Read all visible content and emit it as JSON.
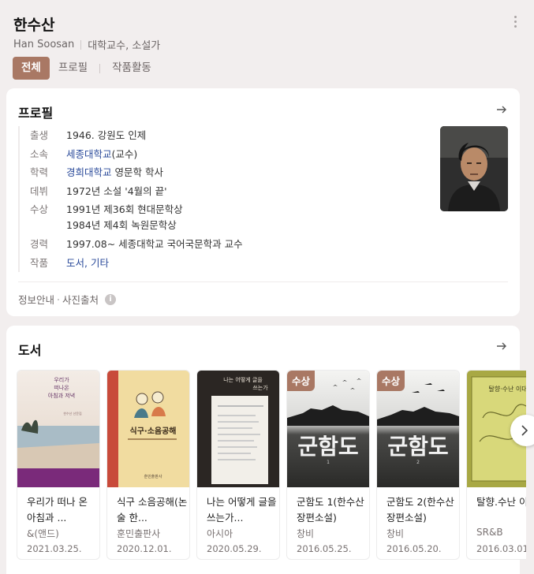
{
  "header": {
    "name": "한수산",
    "name_en": "Han Soosan",
    "occupation": "대학교수, 소설가",
    "tabs": [
      "전체",
      "프로필",
      "작품활동"
    ]
  },
  "profile": {
    "title": "프로필",
    "rows": [
      {
        "label": "출생",
        "value": "1946. 강원도 인제"
      },
      {
        "label": "소속",
        "link": "세종대학교",
        "suffix": "(교수)"
      },
      {
        "label": "학력",
        "link": "경희대학교",
        "suffix": " 영문학 학사"
      },
      {
        "label": "데뷔",
        "value": "1972년 소설 '4월의 끝'"
      },
      {
        "label": "수상",
        "values": [
          "1991년 제36회 현대문학상",
          "1984년 제4회 녹원문학상"
        ]
      },
      {
        "label": "경력",
        "value": "1997.08~ 세종대학교 국어국문학과 교수"
      },
      {
        "label": "작품",
        "link": "도서, 기타"
      }
    ],
    "info_label": "정보안내",
    "photo_source_label": "사진출처",
    "info_icon": "i"
  },
  "books": {
    "title": "도서",
    "badge_label": "수상",
    "items": [
      {
        "title": "우리가 떠나온 아침과 저녁",
        "display_title": "우리가 떠나 온 아침과 ...",
        "publisher": "&(앤드)",
        "date": "2021.03.25.",
        "cover_text": "우리가\n떠나온\n아침과 저녁",
        "award": false
      },
      {
        "title": "식구 소음공해(논술 한...)",
        "display_title": "식구 소음공해(논술 한...",
        "publisher": "훈민출판사",
        "date": "2020.12.01.",
        "cover_text": "식구·소음공해",
        "award": false
      },
      {
        "title": "나는 어떻게 글을 쓰는가",
        "display_title": "나는 어떻게 글을 쓰는가...",
        "publisher": "아시아",
        "date": "2020.05.29.",
        "cover_text": "나는 어떻게 글을\n쓰는가",
        "award": false
      },
      {
        "title": "군함도 1(한수산 장편소설)",
        "display_title": "군함도 1(한수산 장편소설)",
        "publisher": "창비",
        "date": "2016.05.25.",
        "cover_text": "군함도",
        "award": true
      },
      {
        "title": "군함도 2(한수산 장편소설)",
        "display_title": "군함도 2(한수산 장편소설)",
        "publisher": "창비",
        "date": "2016.05.20.",
        "cover_text": "군함도",
        "award": true
      },
      {
        "title": "탈향.수난 이대",
        "display_title": "탈향.수난 이대",
        "publisher": "SR&B",
        "date": "2016.03.01.",
        "cover_text": "탈향·수난 이대",
        "award": false
      }
    ]
  },
  "colors": {
    "accent": "#a97864",
    "link": "#2a4a9a",
    "background": "#f2eeee"
  },
  "icons": [
    "more-vertical-icon",
    "arrow-right-icon",
    "info-icon",
    "chevron-right-icon"
  ]
}
